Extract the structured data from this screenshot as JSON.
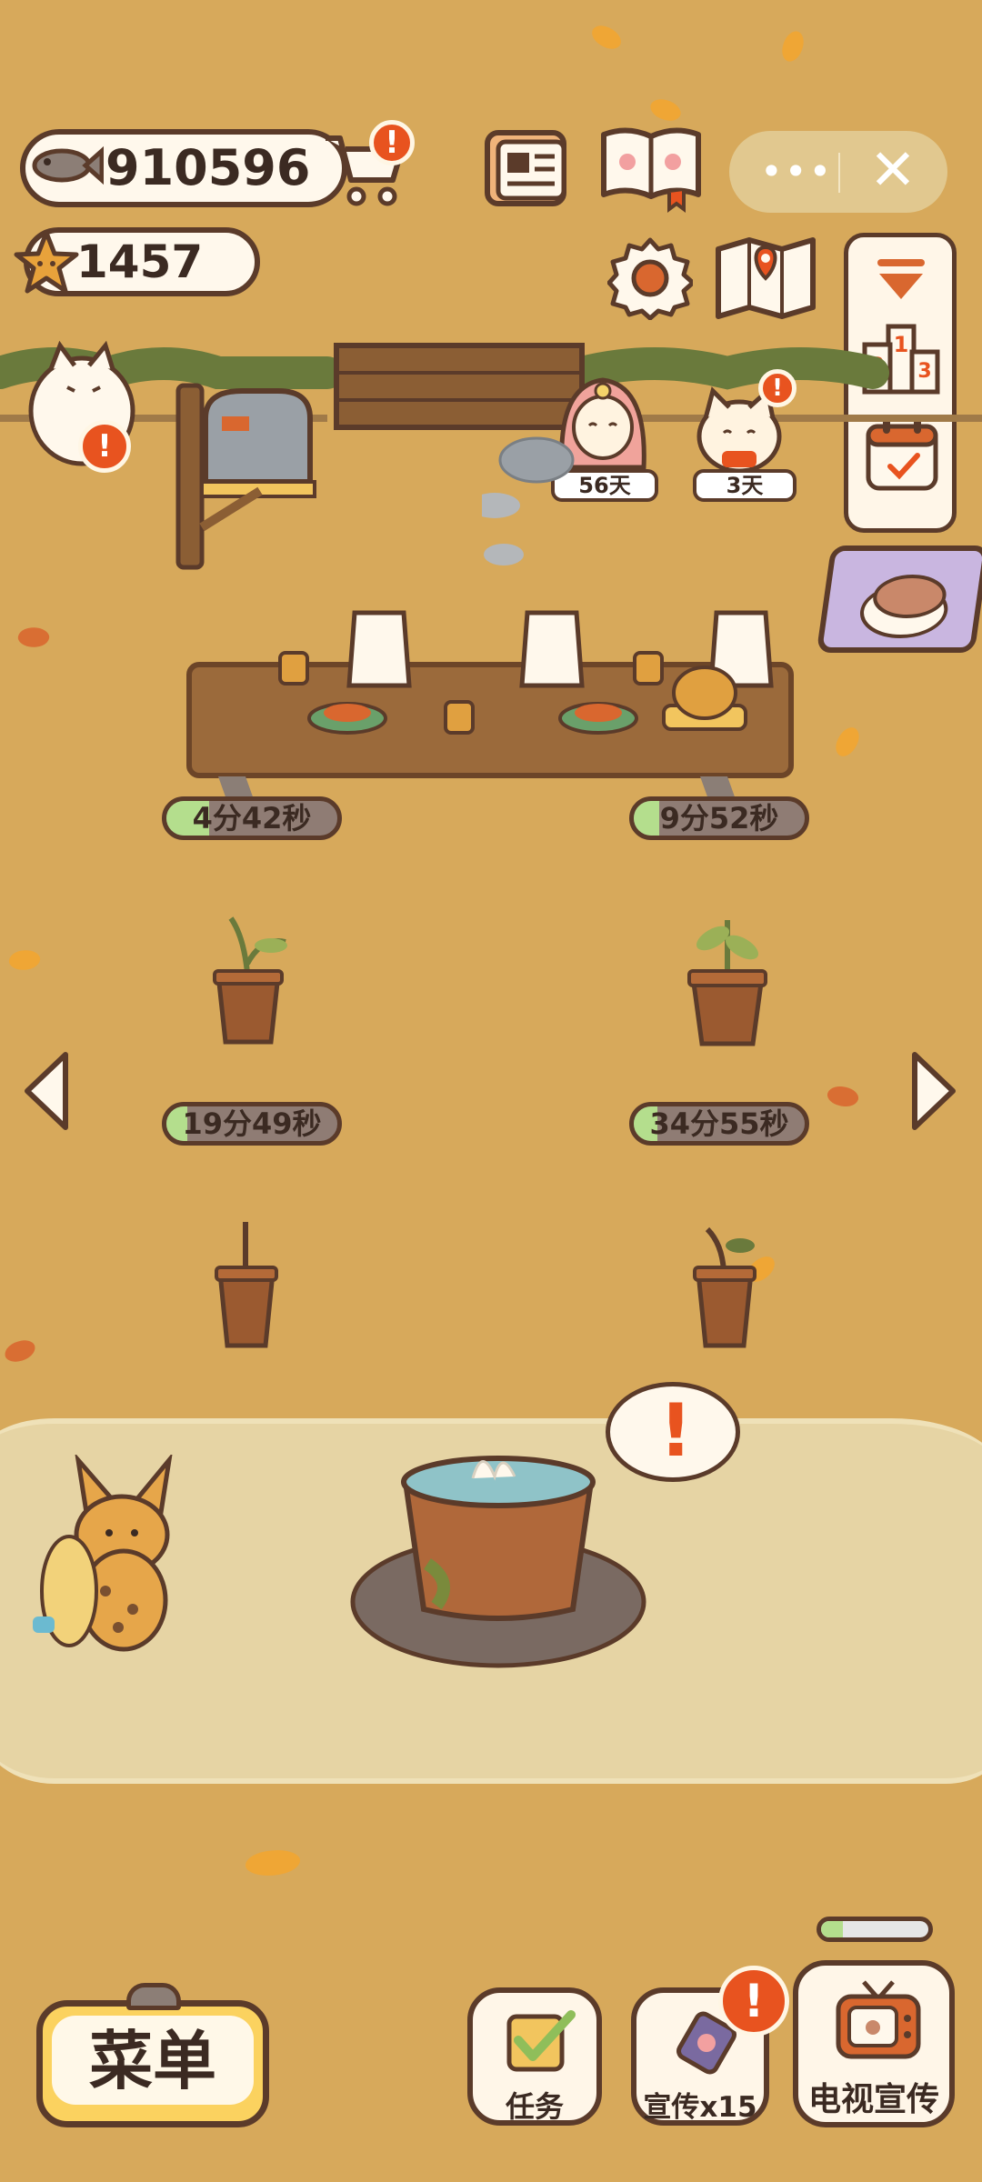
{
  "currency": {
    "fish": "910596",
    "stars": "1457"
  },
  "timers": [
    {
      "label": "4分42秒",
      "progress": 0.25
    },
    {
      "label": "9分52秒",
      "progress": 0.15
    },
    {
      "label": "19分49秒",
      "progress": 0.12
    },
    {
      "label": "34分55秒",
      "progress": 0.14
    }
  ],
  "visitors": [
    {
      "name": "pink-haired-girl",
      "days": "56天"
    },
    {
      "name": "white-cat-guest",
      "days": "3天"
    }
  ],
  "bottom_bar": {
    "menu": "菜单",
    "tasks": "任务",
    "promo": "宣传x15",
    "tv_promo": "电视宣传",
    "tv_progress": 0.2
  },
  "icons": {
    "shop": "shopping-cart-icon",
    "newspaper": "newspaper-icon",
    "book": "paw-book-icon",
    "settings": "gear-icon",
    "map": "map-icon",
    "collapse": "chevron-down-icon",
    "ranking": "podium-icon",
    "calendar": "calendar-icon"
  },
  "colors": {
    "ground": "#d7a95b",
    "outline": "#5b3b2a",
    "badge": "#e8531f",
    "timer_fill": "#b4de8d",
    "menu_yellow": "#fbd25f"
  }
}
